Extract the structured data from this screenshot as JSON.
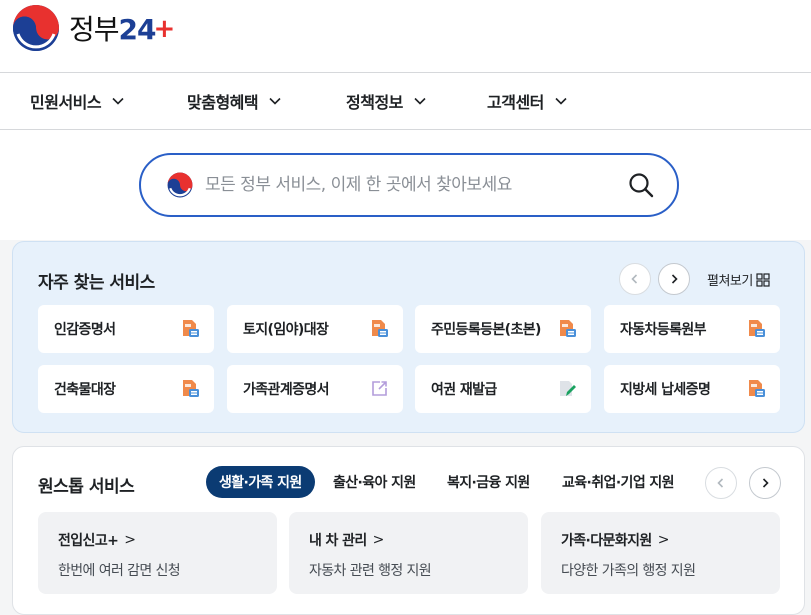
{
  "brand": {
    "logo_text": "정부",
    "logo_num": "2",
    "logo_num2": "4",
    "logo_plus": "+"
  },
  "nav": [
    {
      "label": "민원서비스"
    },
    {
      "label": "맞춤형혜택"
    },
    {
      "label": "정책정보"
    },
    {
      "label": "고객센터"
    }
  ],
  "search": {
    "placeholder": "모든 정부 서비스, 이제 한 곳에서 찾아보세요"
  },
  "frequent": {
    "title": "자주 찾는 서비스",
    "expand_label": "펼쳐보기",
    "items": [
      {
        "label": "인감증명서",
        "icon": "pdf-document-icon"
      },
      {
        "label": "토지(임야)대장",
        "icon": "pdf-document-icon"
      },
      {
        "label": "주민등록등본(초본)",
        "icon": "pdf-document-icon"
      },
      {
        "label": "자동차등록원부",
        "icon": "pdf-document-icon"
      },
      {
        "label": "건축물대장",
        "icon": "pdf-document-icon"
      },
      {
        "label": "가족관계증명서",
        "icon": "external-link-icon"
      },
      {
        "label": "여권 재발급",
        "icon": "edit-document-icon"
      },
      {
        "label": "지방세 납세증명",
        "icon": "pdf-document-icon"
      }
    ]
  },
  "onestop": {
    "title": "원스톱 서비스",
    "tabs": [
      {
        "label": "생활·가족 지원",
        "active": true
      },
      {
        "label": "출산·육아 지원",
        "active": false
      },
      {
        "label": "복지·금융 지원",
        "active": false
      },
      {
        "label": "교육·취업·기업 지원",
        "active": false
      }
    ],
    "cards": [
      {
        "title": "전입신고+",
        "desc": "한번에 여러 감면 신청"
      },
      {
        "title": "내 차 관리",
        "desc": "자동차 관련 행정 지원"
      },
      {
        "title": "가족·다문화지원",
        "desc": "다양한 가족의 행정 지원"
      }
    ]
  },
  "colors": {
    "primary": "#0b3b73",
    "search_border": "#2a5fc7",
    "panel_bg": "#e7f1fb",
    "pdf_icon": "#f08a4b"
  }
}
